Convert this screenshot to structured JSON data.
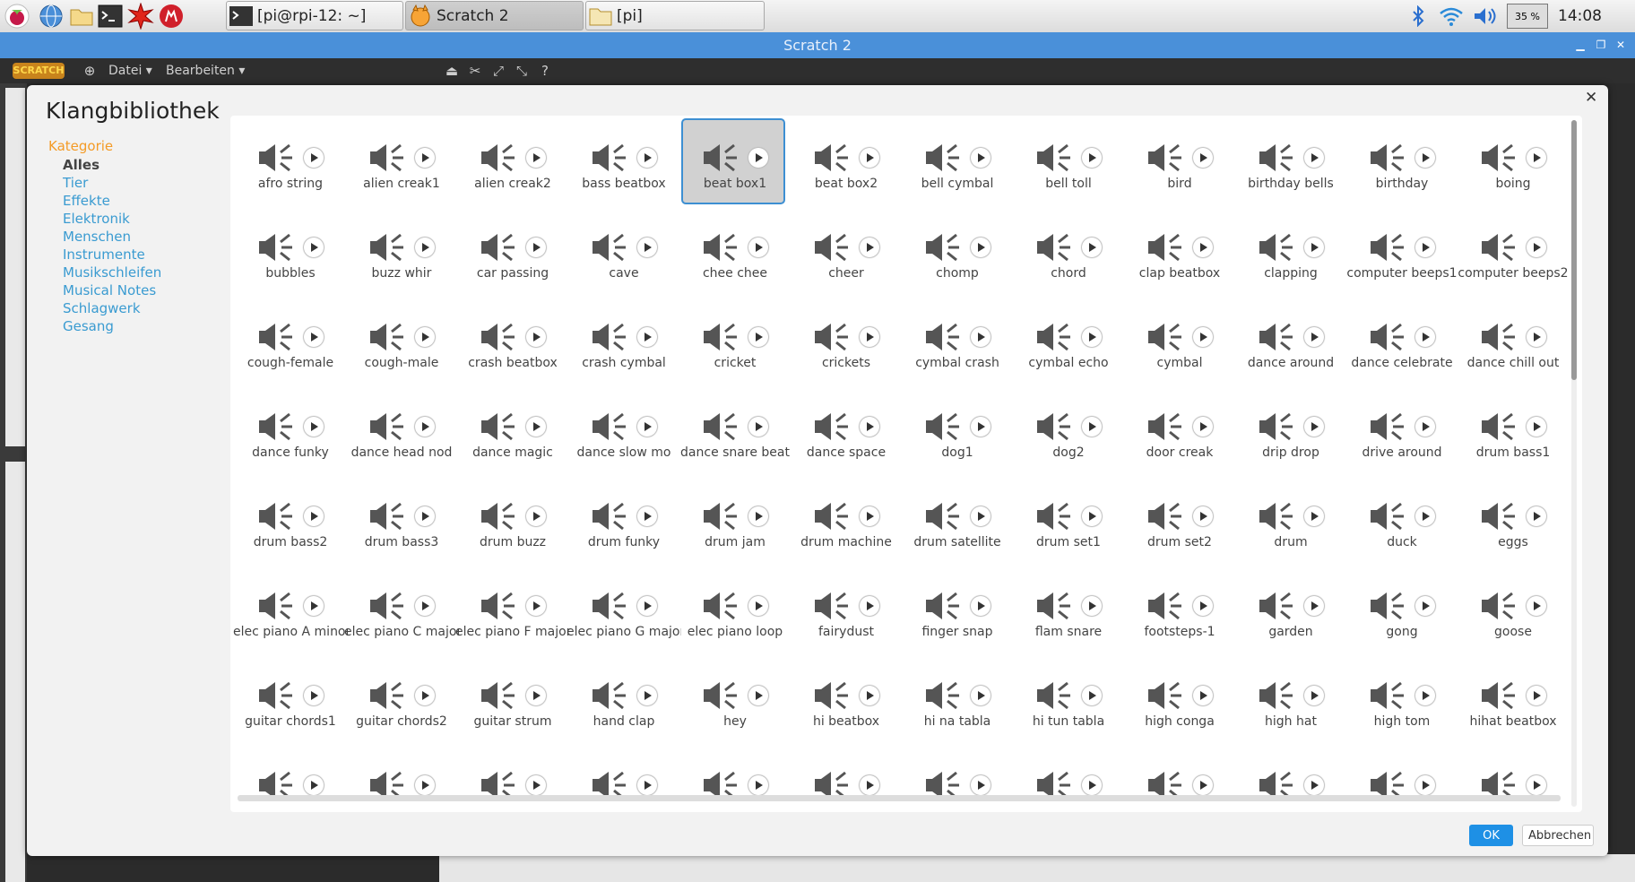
{
  "taskbar": {
    "tasks": [
      {
        "label": "[pi@rpi-12: ~]",
        "icon": "terminal-icon"
      },
      {
        "label": "Scratch 2",
        "icon": "scratch-cat-icon"
      },
      {
        "label": "[pi]",
        "icon": "folder-icon"
      }
    ],
    "battery": "35 %",
    "clock": "14:08",
    "colors": {
      "accent": "#4a90d9"
    }
  },
  "window": {
    "title": "Scratch 2"
  },
  "scratch_menu": {
    "logo": "SCRATCH",
    "file": "Datei ▾",
    "edit": "Bearbeiten ▾"
  },
  "dialog": {
    "title": "Klangbibliothek",
    "category_heading": "Kategorie",
    "categories": [
      "Alles",
      "Tier",
      "Effekte",
      "Elektronik",
      "Menschen",
      "Instrumente",
      "Musikschleifen",
      "Musical Notes",
      "Schlagwerk",
      "Gesang"
    ],
    "selected_category": "Alles",
    "selected_sound": "beat box1",
    "sounds": [
      "afro string",
      "alien creak1",
      "alien creak2",
      "bass beatbox",
      "beat box1",
      "beat box2",
      "bell cymbal",
      "bell toll",
      "bird",
      "birthday bells",
      "birthday",
      "boing",
      "bubbles",
      "buzz whir",
      "car passing",
      "cave",
      "chee chee",
      "cheer",
      "chomp",
      "chord",
      "clap beatbox",
      "clapping",
      "computer beeps1",
      "computer beeps2",
      "cough-female",
      "cough-male",
      "crash beatbox",
      "crash cymbal",
      "cricket",
      "crickets",
      "cymbal crash",
      "cymbal echo",
      "cymbal",
      "dance around",
      "dance celebrate",
      "dance chill out",
      "dance funky",
      "dance head nod",
      "dance magic",
      "dance slow mo",
      "dance snare beat",
      "dance space",
      "dog1",
      "dog2",
      "door creak",
      "drip drop",
      "drive around",
      "drum bass1",
      "drum bass2",
      "drum bass3",
      "drum buzz",
      "drum funky",
      "drum jam",
      "drum machine",
      "drum satellite",
      "drum set1",
      "drum set2",
      "drum",
      "duck",
      "eggs",
      "elec piano A minor",
      "elec piano C major",
      "elec piano F major",
      "elec piano G major",
      "elec piano loop",
      "fairydust",
      "finger snap",
      "flam snare",
      "footsteps-1",
      "garden",
      "gong",
      "goose",
      "guitar chords1",
      "guitar chords2",
      "guitar strum",
      "hand clap",
      "hey",
      "hi beatbox",
      "hi na tabla",
      "hi tun tabla",
      "high conga",
      "high hat",
      "high tom",
      "hihat beatbox"
    ],
    "partial_row_count": 12,
    "ok_label": "OK",
    "cancel_label": "Abbrechen",
    "colors": {
      "category_heading": "#f49b26",
      "category_link": "#3a9bd1",
      "ok_button": "#1e90e5",
      "selection_border": "#3d8fd2"
    }
  }
}
